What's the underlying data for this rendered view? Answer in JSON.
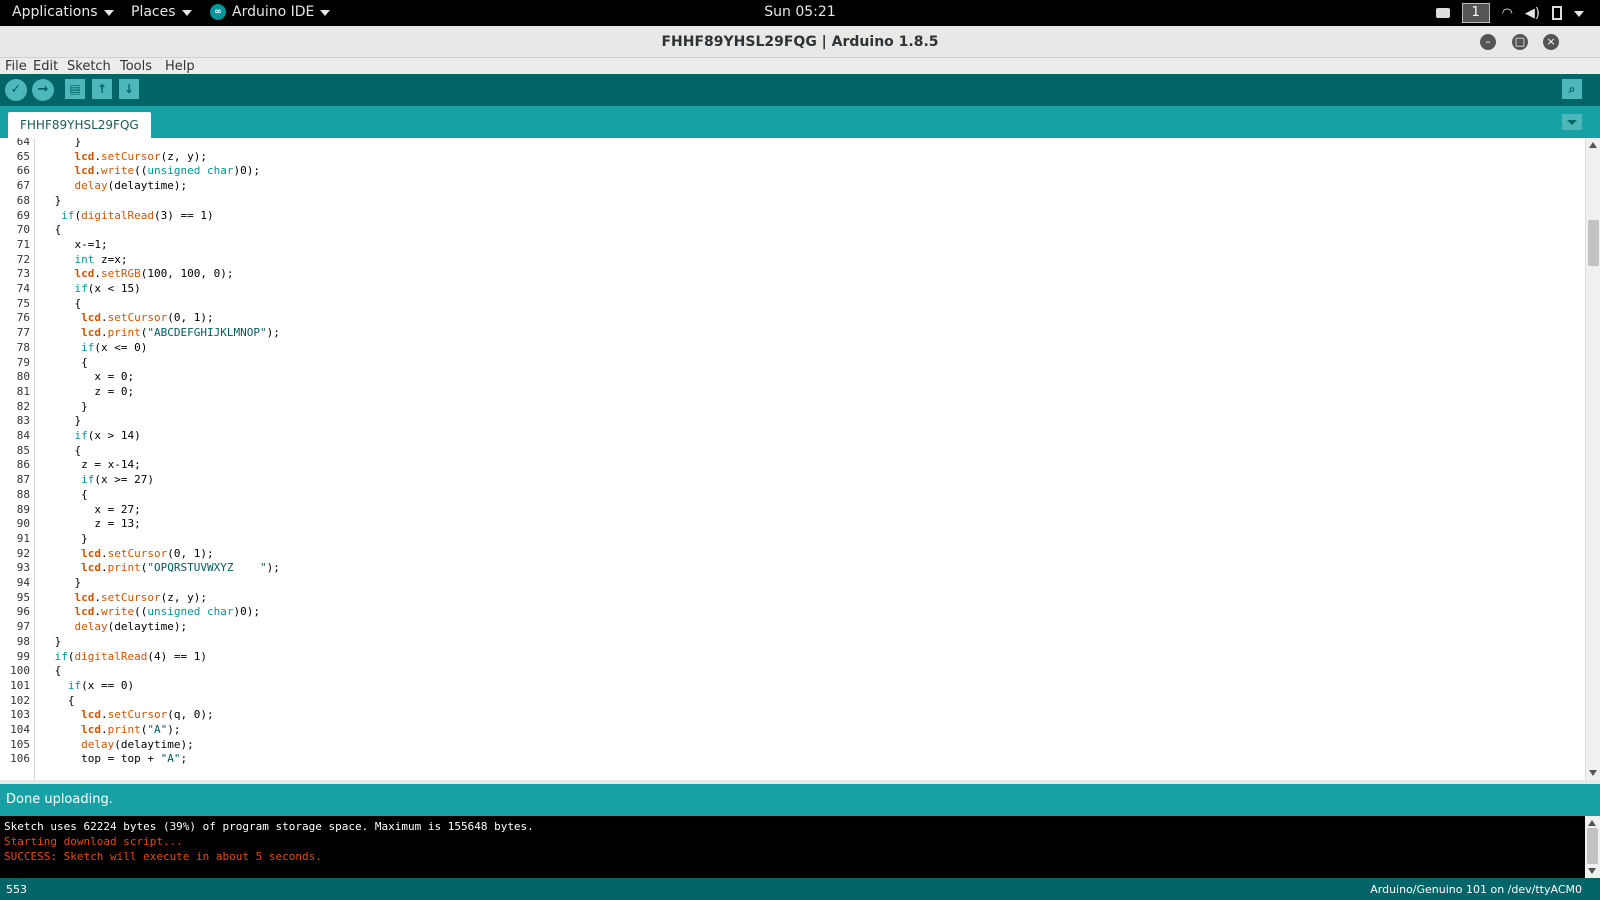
{
  "topbar": {
    "applications_label": "Applications",
    "places_label": "Places",
    "app_label": "Arduino IDE",
    "clock": "Sun 05:21",
    "workspace": "1"
  },
  "window": {
    "title": "FHHF89YHSL29FQG | Arduino 1.8.5"
  },
  "menubar": {
    "items": [
      "File",
      "Edit",
      "Sketch",
      "Tools",
      "Help"
    ]
  },
  "tabs": {
    "active": "FHHF89YHSL29FQG"
  },
  "editor": {
    "line_numbers": [
      "64",
      "65",
      "66",
      "67",
      "68",
      "69",
      "70",
      "71",
      "72",
      "73",
      "74",
      "75",
      "76",
      "77",
      "78",
      "79",
      "80",
      "81",
      "82",
      "83",
      "84",
      "85",
      "86",
      "87",
      "88",
      "89",
      "90",
      "91",
      "92",
      "93",
      "94",
      "95",
      "96",
      "97",
      "98",
      "99",
      "100",
      "101",
      "102",
      "103",
      "104",
      "105",
      "106"
    ],
    "lines": [
      "    }",
      "    lcd.setCursor(z, y);",
      "    lcd.write((unsigned char)0);",
      "    delay(delaytime);",
      " }",
      "  if(digitalRead(3) == 1)",
      " {",
      "    x-=1;",
      "    int z=x;",
      "    lcd.setRGB(100, 100, 0);",
      "    if(x < 15)",
      "    {",
      "     lcd.setCursor(0, 1);",
      "     lcd.print(\"ABCDEFGHIJKLMNOP\");",
      "     if(x <= 0)",
      "     {",
      "       x = 0;",
      "       z = 0;",
      "     }",
      "    }",
      "    if(x > 14)",
      "    {",
      "     z = x-14;",
      "     if(x >= 27)",
      "     {",
      "       x = 27;",
      "       z = 13;",
      "     }",
      "     lcd.setCursor(0, 1);",
      "     lcd.print(\"OPQRSTUVWXYZ    \");",
      "    }",
      "    lcd.setCursor(z, y);",
      "    lcd.write((unsigned char)0);",
      "    delay(delaytime);",
      " }",
      " if(digitalRead(4) == 1)",
      " {",
      "   if(x == 0)",
      "   {",
      "     lcd.setCursor(q, 0);",
      "     lcd.print(\"A\");",
      "     delay(delaytime);",
      "     top = top + \"A\";"
    ]
  },
  "status": {
    "message": "Done uploading."
  },
  "console": {
    "lines": [
      {
        "text": "Sketch uses 62224 bytes (39%) of program storage space. Maximum is 155648 bytes.",
        "color": "#ffffff"
      },
      {
        "text": "Starting download script...",
        "color": "#e34c00"
      },
      {
        "text": "SUCCESS: Sketch will execute in about 5 seconds.",
        "color": "#e34c00"
      }
    ]
  },
  "footer": {
    "line": "553",
    "board": "Arduino/Genuino 101 on /dev/ttyACM0"
  },
  "colors": {
    "toolbar": "#006468",
    "tabstrip": "#17a1a5",
    "accent": "#4db7bb",
    "function": "#d35400",
    "keyword": "#00979c"
  }
}
